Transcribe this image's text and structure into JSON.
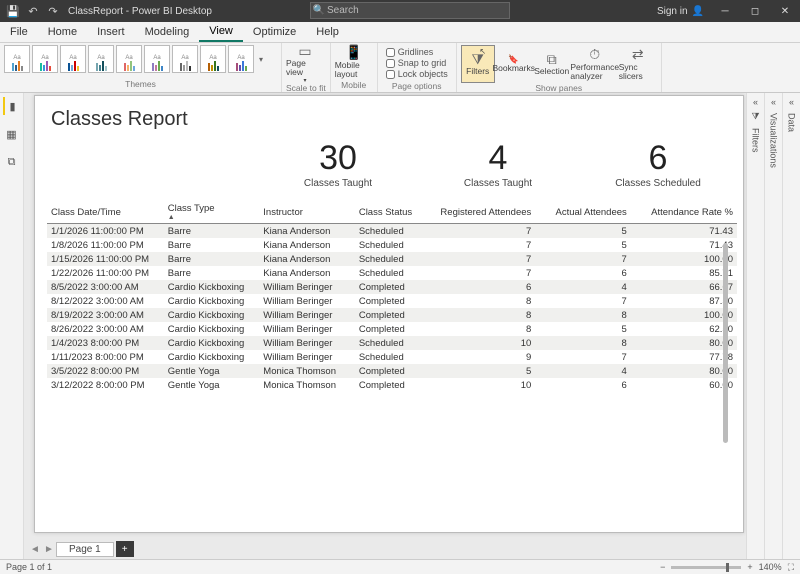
{
  "titlebar": {
    "title": "ClassReport - Power BI Desktop",
    "search_placeholder": "Search",
    "signin": "Sign in"
  },
  "menu": [
    "File",
    "Home",
    "Insert",
    "Modeling",
    "View",
    "Optimize",
    "Help"
  ],
  "menu_active": 4,
  "ribbon": {
    "groups": {
      "themes": "Themes",
      "scale": "Scale to fit",
      "mobile": "Mobile",
      "page_options": "Page options",
      "show_panes": "Show panes"
    },
    "page_view": "Page view",
    "mobile_layout": "Mobile layout",
    "gridlines": "Gridlines",
    "snap": "Snap to grid",
    "lock": "Lock objects",
    "filters": "Filters",
    "bookmarks": "Bookmarks",
    "selection": "Selection",
    "perf": "Performance analyzer",
    "sync": "Sync slicers"
  },
  "report": {
    "title": "Classes Report",
    "kpis": [
      {
        "value": "30",
        "label": "Classes Taught"
      },
      {
        "value": "4",
        "label": "Classes Taught"
      },
      {
        "value": "6",
        "label": "Classes Scheduled"
      }
    ],
    "columns": [
      "Class Date/Time",
      "Class Type",
      "Instructor",
      "Class Status",
      "Registered Attendees",
      "Actual Attendees",
      "Attendance Rate %"
    ],
    "rows": [
      [
        "1/1/2026 11:00:00 PM",
        "Barre",
        "Kiana Anderson",
        "Scheduled",
        "7",
        "5",
        "71.43"
      ],
      [
        "1/8/2026 11:00:00 PM",
        "Barre",
        "Kiana Anderson",
        "Scheduled",
        "7",
        "5",
        "71.43"
      ],
      [
        "1/15/2026 11:00:00 PM",
        "Barre",
        "Kiana Anderson",
        "Scheduled",
        "7",
        "7",
        "100.00"
      ],
      [
        "1/22/2026 11:00:00 PM",
        "Barre",
        "Kiana Anderson",
        "Scheduled",
        "7",
        "6",
        "85.71"
      ],
      [
        "8/5/2022 3:00:00 AM",
        "Cardio Kickboxing",
        "William Beringer",
        "Completed",
        "6",
        "4",
        "66.67"
      ],
      [
        "8/12/2022 3:00:00 AM",
        "Cardio Kickboxing",
        "William Beringer",
        "Completed",
        "8",
        "7",
        "87.50"
      ],
      [
        "8/19/2022 3:00:00 AM",
        "Cardio Kickboxing",
        "William Beringer",
        "Completed",
        "8",
        "8",
        "100.00"
      ],
      [
        "8/26/2022 3:00:00 AM",
        "Cardio Kickboxing",
        "William Beringer",
        "Completed",
        "8",
        "5",
        "62.50"
      ],
      [
        "1/4/2023 8:00:00 PM",
        "Cardio Kickboxing",
        "William Beringer",
        "Scheduled",
        "10",
        "8",
        "80.00"
      ],
      [
        "1/11/2023 8:00:00 PM",
        "Cardio Kickboxing",
        "William Beringer",
        "Scheduled",
        "9",
        "7",
        "77.78"
      ],
      [
        "3/5/2022 8:00:00 PM",
        "Gentle Yoga",
        "Monica Thomson",
        "Completed",
        "5",
        "4",
        "80.00"
      ],
      [
        "3/12/2022 8:00:00 PM",
        "Gentle Yoga",
        "Monica Thomson",
        "Completed",
        "10",
        "6",
        "60.00"
      ]
    ]
  },
  "right_panes": {
    "filters": "Filters",
    "visualizations": "Visualizations",
    "data": "Data"
  },
  "page_tab": "Page 1",
  "status": {
    "left": "Page 1 of 1",
    "zoom": "140%"
  }
}
